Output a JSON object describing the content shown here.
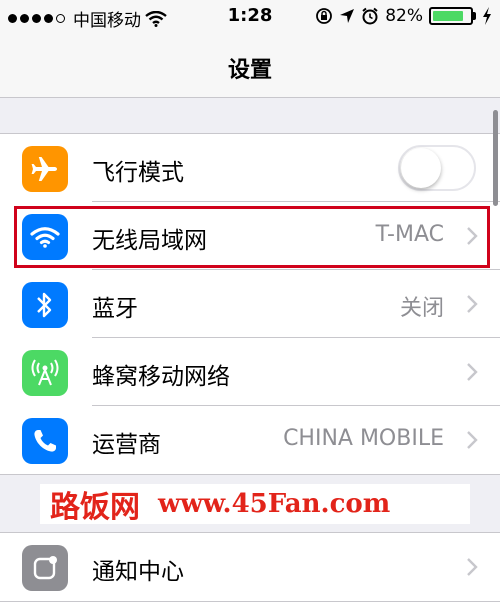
{
  "status_bar": {
    "carrier": "中国移动",
    "time": "1:28",
    "battery_percent": "82%",
    "battery_level": 0.82,
    "signal_bars_filled": 4,
    "signal_bars_total": 5,
    "icons": [
      "wifi-icon",
      "rotation-lock-icon",
      "location-icon",
      "alarm-icon",
      "battery-icon",
      "charging-icon"
    ]
  },
  "nav": {
    "title": "设置"
  },
  "groups": [
    {
      "rows": [
        {
          "label": "飞行模式",
          "icon": "airplane-icon",
          "icon_color": "#ff9500",
          "control": "toggle",
          "toggle_on": false
        },
        {
          "label": "无线局域网",
          "icon": "wifi-icon",
          "icon_color": "#007aff",
          "value": "T-MAC",
          "highlighted": true
        },
        {
          "label": "蓝牙",
          "icon": "bluetooth-icon",
          "icon_color": "#007aff",
          "value": "关闭"
        },
        {
          "label": "蜂窝移动网络",
          "icon": "cellular-icon",
          "icon_color": "#4cd964",
          "value": ""
        },
        {
          "label": "运营商",
          "icon": "phone-icon",
          "icon_color": "#007aff",
          "value": "CHINA MOBILE"
        }
      ]
    },
    {
      "rows": [
        {
          "label": "通知中心",
          "icon": "notification-center-icon",
          "icon_color": "#8e8e93",
          "value": ""
        }
      ]
    }
  ],
  "watermark": {
    "cn": "路饭网",
    "url": "www.45Fan.com"
  },
  "colors": {
    "highlight_border": "#d0021b",
    "watermark": "#e2241a",
    "accent": "#007aff"
  }
}
